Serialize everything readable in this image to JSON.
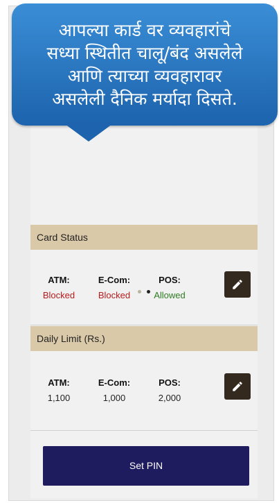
{
  "callout": {
    "text": "आपल्या कार्ड वर व्यवहारांचे\nसध्या स्थितीत चालू/बंद असलेले\nआणि त्याच्या व्यवहारावर\nअसलेली दैनिक मर्यादा दिसते."
  },
  "pager": {
    "count": 2,
    "active": 2
  },
  "card_status": {
    "title": "Card Status",
    "atm_label": "ATM:",
    "atm_value": "Blocked",
    "ecom_label": "E-Com:",
    "ecom_value": "Blocked",
    "pos_label": "POS:",
    "pos_value": "Allowed",
    "blocked_color": "#b51c1c",
    "allowed_color": "#2e7d22"
  },
  "daily_limit": {
    "title": "Daily Limit (Rs.)",
    "atm_label": "ATM:",
    "atm_value": "1,100",
    "ecom_label": "E-Com:",
    "ecom_value": "1,000",
    "pos_label": "POS:",
    "pos_value": "2,000"
  },
  "set_pin_label": "Set PIN",
  "icons": {
    "edit": "pencil-icon"
  },
  "colors": {
    "callout": "#2a7cc8",
    "header": "#dac9a8",
    "button": "#1e1b5e",
    "edit_button": "#34291f"
  }
}
